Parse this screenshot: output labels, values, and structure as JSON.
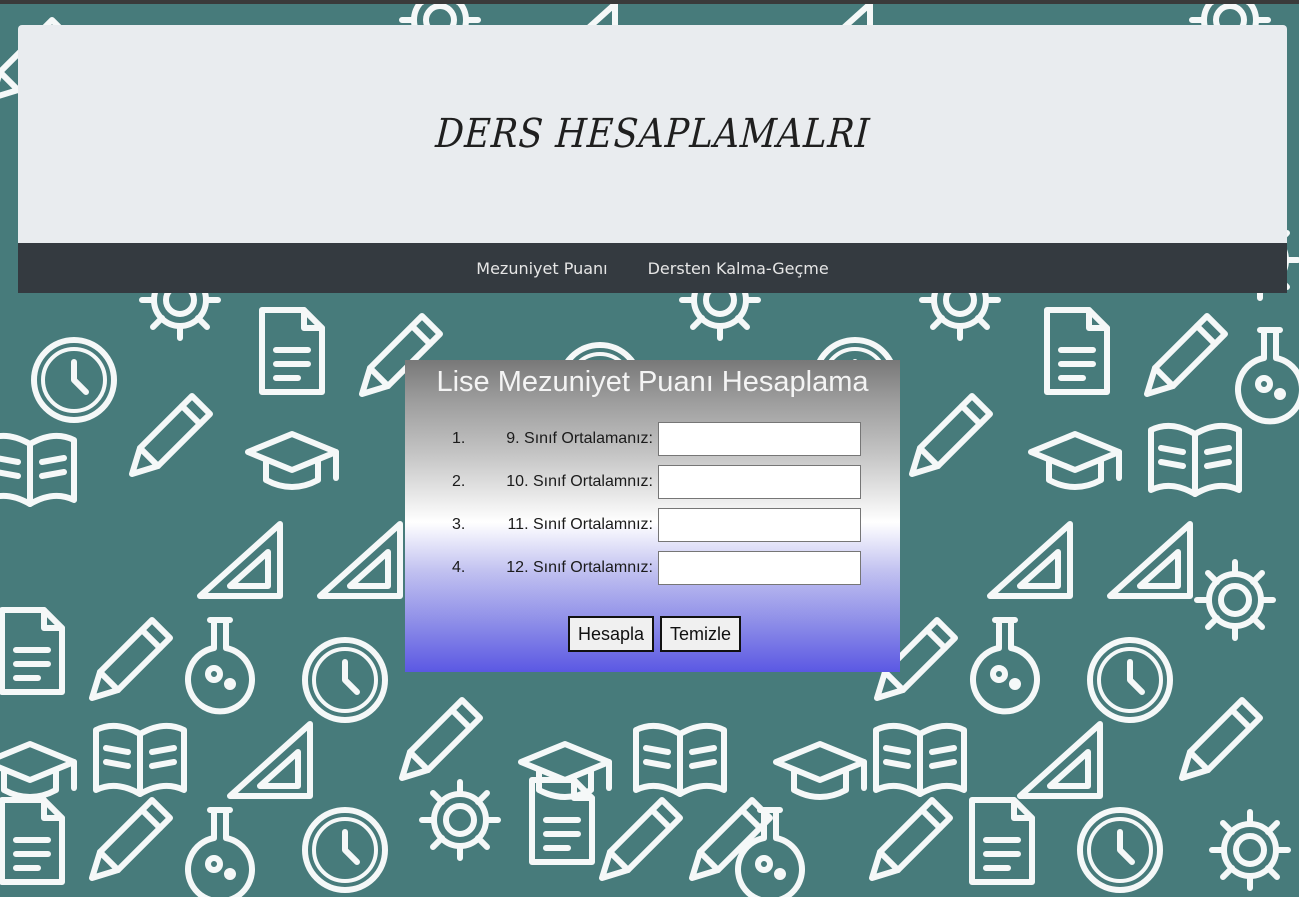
{
  "header": {
    "title": "DERS HESAPLAMALRI"
  },
  "navbar": {
    "items": [
      {
        "label": "Mezuniyet Puanı"
      },
      {
        "label": "Dersten Kalma-Geçme"
      }
    ]
  },
  "calculator": {
    "title": "Lise Mezuniyet Puanı Hesaplama",
    "fields": [
      {
        "number": "1.",
        "label": "9. Sınıf Ortalamanız:",
        "value": ""
      },
      {
        "number": "2.",
        "label": "10. Sınıf Ortalamnız:",
        "value": ""
      },
      {
        "number": "3.",
        "label": "11. Sınıf Ortalamnız:",
        "value": ""
      },
      {
        "number": "4.",
        "label": "12. Sınıf Ortalamnız:",
        "value": ""
      }
    ],
    "calculate_label": "Hesapla",
    "clear_label": "Temizle"
  },
  "colors": {
    "background": "#477b7b",
    "jumbotron": "#e9ecef",
    "navbar": "#343a40",
    "panel_gradient_top": "#787878",
    "panel_gradient_bottom": "#5b58e3"
  }
}
